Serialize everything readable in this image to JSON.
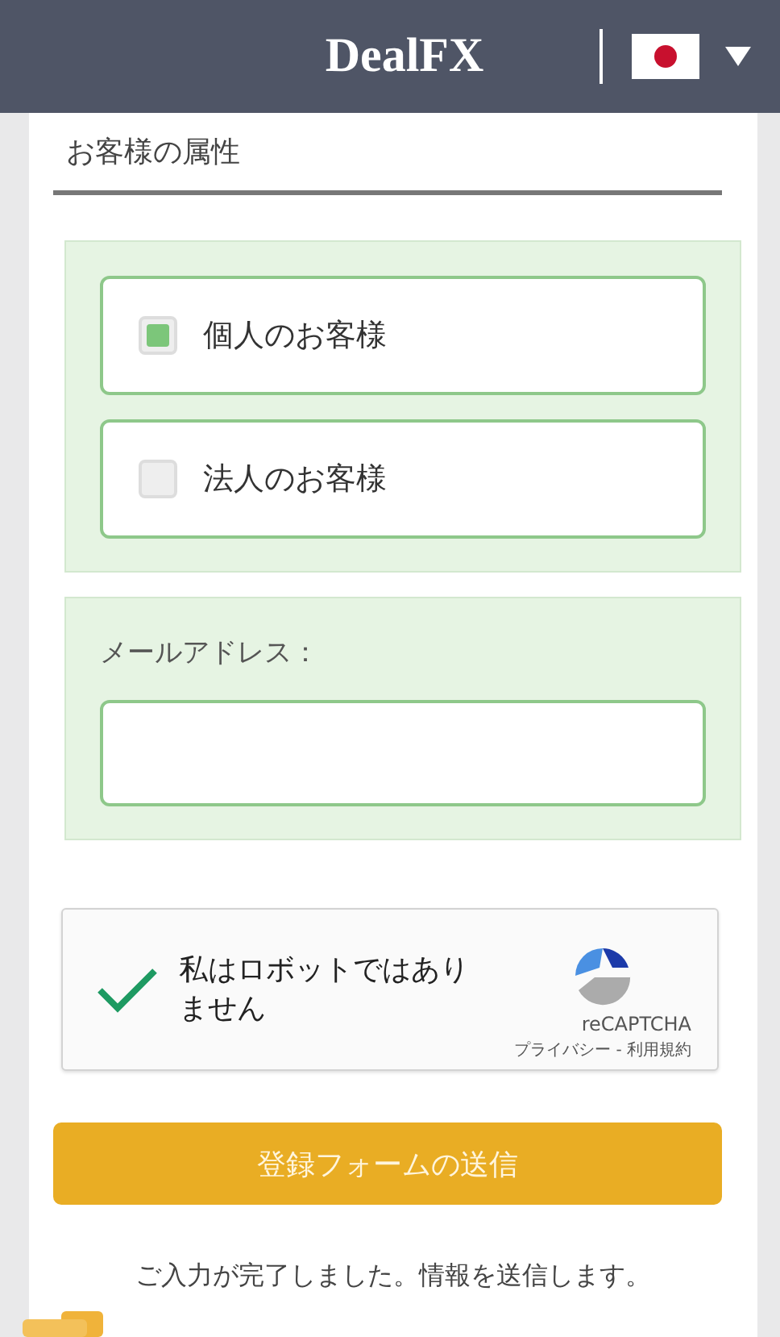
{
  "header": {
    "logo": "DealFX"
  },
  "section_title": "お客様の属性",
  "customer_types": [
    {
      "label": "個人のお客様",
      "selected": true
    },
    {
      "label": "法人のお客様",
      "selected": false
    }
  ],
  "email": {
    "label": "メールアドレス："
  },
  "captcha": {
    "label": "私はロボットではありません",
    "checked": true,
    "brand": "reCAPTCHA",
    "links": "プライバシー - 利用規約"
  },
  "submit": "登録フォームの送信",
  "message": "ご入力が完了しました。情報を送信します。"
}
